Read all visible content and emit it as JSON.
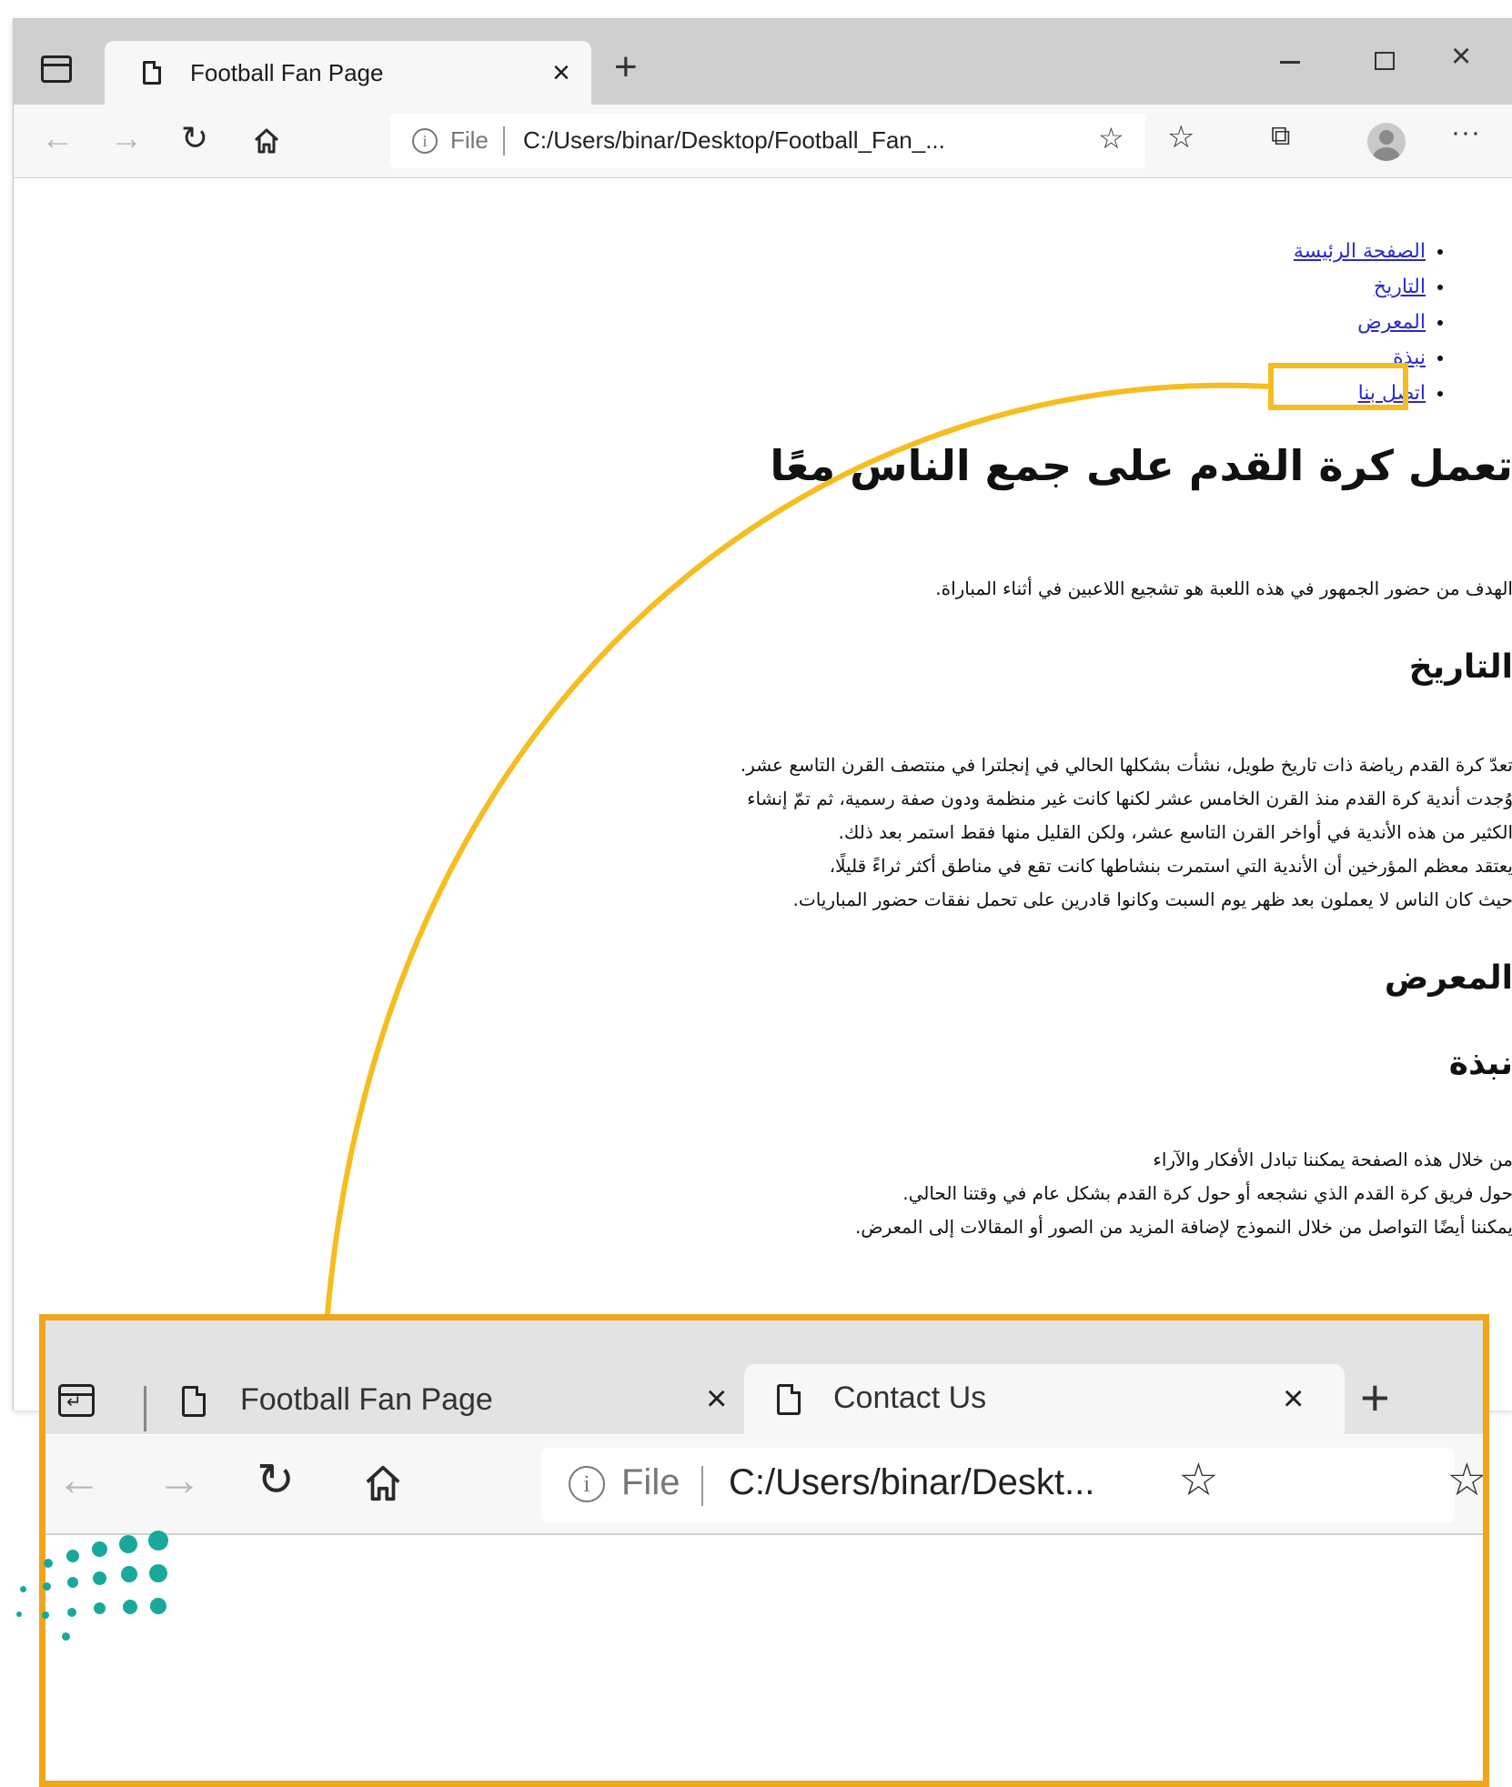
{
  "browser": {
    "tab_title": "Football Fan Page",
    "close_glyph": "×",
    "new_tab_glyph": "+",
    "address": {
      "info_glyph": "i",
      "file_label": "File",
      "url": "C:/Users/binar/Desktop/Football_Fan_..."
    },
    "window_controls": {
      "close_glyph": "×"
    }
  },
  "page": {
    "nav": [
      "الصفحة الرئيسة",
      "التاريخ",
      "المعرض",
      "نبذة",
      "اتصل بنا"
    ],
    "heading": "تعمل كرة القدم على جمع الناس معًا",
    "intro": "الهدف من حضور الجمهور في هذه اللعبة هو تشجيع اللاعبين في أثناء المباراة.",
    "history_heading": "التاريخ",
    "history_lines": [
      "تعدّ كرة القدم رياضة ذات تاريخ طويل، نشأت بشكلها الحالي في إنجلترا في منتصف القرن التاسع عشر.",
      "وُجدت أندية كرة القدم منذ القرن الخامس عشر لكنها كانت غير منظمة ودون صفة رسمية، ثم تمّ إنشاء",
      "الكثير من هذه الأندية في أواخر القرن التاسع عشر، ولكن القليل منها فقط استمر بعد ذلك.",
      "يعتقد معظم المؤرخين أن الأندية التي استمرت بنشاطها كانت تقع في مناطق أكثر ثراءً قليلًا،",
      "حيث كان الناس لا يعملون بعد ظهر يوم السبت وكانوا قادرين على تحمل نفقات حضور المباريات."
    ],
    "gallery_heading": "المعرض",
    "about_heading": "نبذة",
    "about_lines": [
      "من خلال هذه الصفحة يمكننا تبادل الأفكار والآراء",
      "حول فريق كرة القدم الذي نشجعه أو حول كرة القدم بشكل عام في وقتنا الحالي.",
      "يمكننا أيضًا التواصل من خلال النموذج لإضافة المزيد من الصور أو المقالات إلى المعرض."
    ]
  },
  "zoom": {
    "tab1_title": "Football Fan Page",
    "tab2_title": "Contact Us",
    "close_glyph": "×",
    "new_tab_glyph": "+",
    "file_label": "File",
    "info_glyph": "i",
    "url": "C:/Users/binar/Deskt..."
  },
  "colors": {
    "highlight_yellow": "#f5bd1f",
    "callout_orange": "#f0a51c",
    "link_blue": "#2b2bc8",
    "logo_teal": "#18a99a"
  },
  "icons": [
    "tab-actions-icon",
    "page-icon",
    "back-arrow-icon",
    "forward-arrow-icon",
    "refresh-icon",
    "home-icon",
    "info-icon",
    "add-favorite-icon",
    "favorites-icon",
    "collections-icon",
    "profile-avatar",
    "more-icon",
    "minimize-icon",
    "maximize-icon",
    "window-close-icon"
  ]
}
